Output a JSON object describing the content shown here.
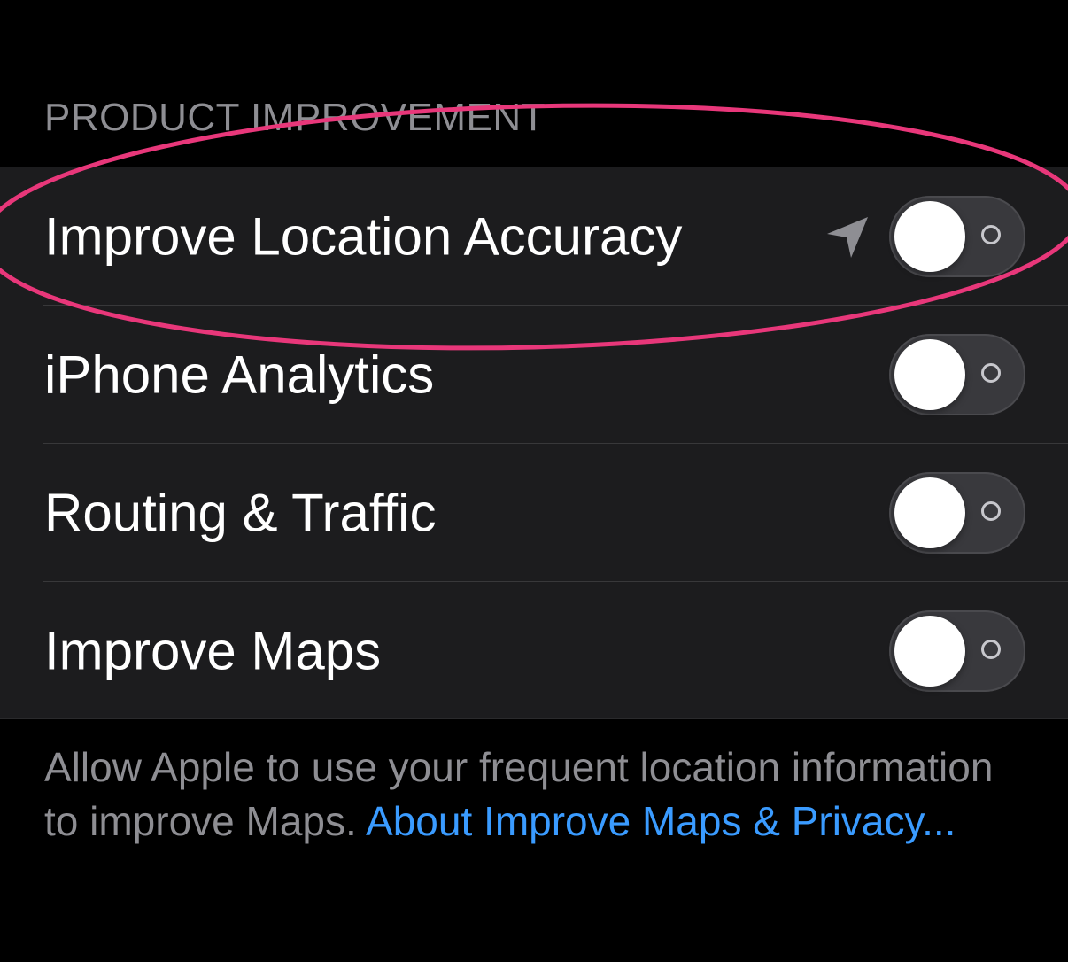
{
  "section": {
    "header": "PRODUCT IMPROVEMENT"
  },
  "rows": [
    {
      "label": "Improve Location Accuracy",
      "toggle_on": false,
      "has_location_icon": true
    },
    {
      "label": "iPhone Analytics",
      "toggle_on": false
    },
    {
      "label": "Routing & Traffic",
      "toggle_on": false
    },
    {
      "label": "Improve Maps",
      "toggle_on": false
    }
  ],
  "footer": {
    "text": "Allow Apple to use your frequent location information to improve Maps. ",
    "link": "About Improve Maps & Privacy..."
  },
  "icons": {
    "location": "location-arrow-icon"
  },
  "colors": {
    "background": "#000000",
    "group_background": "#1c1c1e",
    "secondary_text": "#8e8e93",
    "link": "#3a9bff",
    "annotation": "#e8377a"
  }
}
